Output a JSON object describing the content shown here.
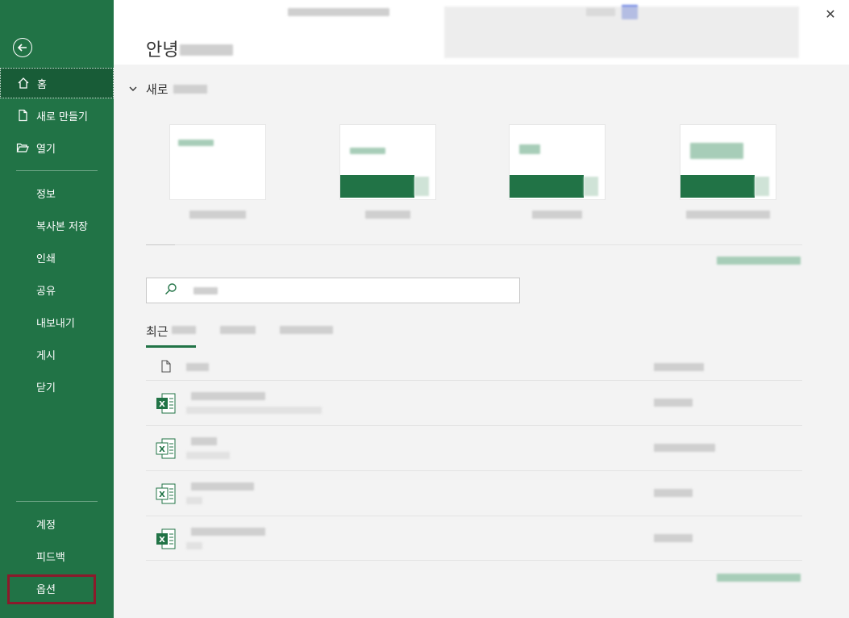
{
  "sidebar": {
    "items": [
      {
        "label": "홈"
      },
      {
        "label": "새로 만들기"
      },
      {
        "label": "열기"
      },
      {
        "label": "정보"
      },
      {
        "label": "복사본 저장"
      },
      {
        "label": "인쇄"
      },
      {
        "label": "공유"
      },
      {
        "label": "내보내기"
      },
      {
        "label": "게시"
      },
      {
        "label": "닫기"
      },
      {
        "label": "계정"
      },
      {
        "label": "피드백"
      },
      {
        "label": "옵션"
      }
    ],
    "highlight_color": "#8b1a2b"
  },
  "main": {
    "greeting": "안녕",
    "new_section": {
      "label": "새로"
    },
    "tab_recent": "최근",
    "close_glyph": "✕"
  },
  "colors": {
    "brand": "#217346",
    "brand_dark": "#185c37",
    "background": "#f3f3f3"
  }
}
